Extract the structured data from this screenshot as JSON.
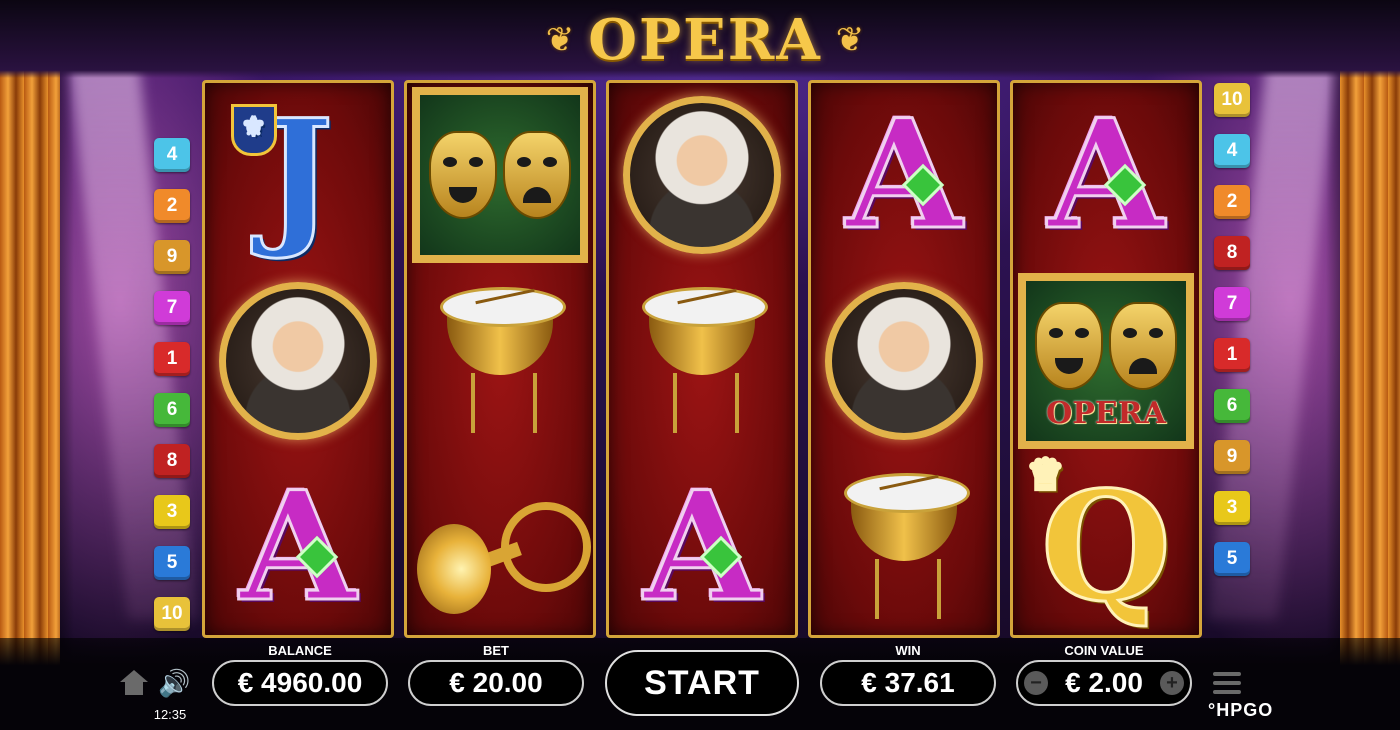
{
  "game": {
    "title": "OPERA",
    "title_color": "#f6c84a"
  },
  "reels": [
    [
      {
        "symbol": "J",
        "kind": "letter",
        "extra": "fleur-de-lis-crest"
      },
      {
        "symbol": "composer",
        "kind": "portrait"
      },
      {
        "symbol": "A",
        "kind": "letter",
        "extra": "green-gem"
      }
    ],
    [
      {
        "symbol": "masks",
        "kind": "masks",
        "label": ""
      },
      {
        "symbol": "timpani",
        "kind": "drum"
      },
      {
        "symbol": "horn",
        "kind": "horn"
      }
    ],
    [
      {
        "symbol": "composer",
        "kind": "portrait"
      },
      {
        "symbol": "timpani",
        "kind": "drum"
      },
      {
        "symbol": "A",
        "kind": "letter",
        "extra": "green-gem"
      }
    ],
    [
      {
        "symbol": "A",
        "kind": "letter",
        "extra": "green-gem"
      },
      {
        "symbol": "composer",
        "kind": "portrait"
      },
      {
        "symbol": "timpani",
        "kind": "drum"
      }
    ],
    [
      {
        "symbol": "A",
        "kind": "letter",
        "extra": "green-gem"
      },
      {
        "symbol": "masks",
        "kind": "masks",
        "label": "OPERA"
      },
      {
        "symbol": "Q",
        "kind": "letter",
        "extra": "crown"
      }
    ]
  ],
  "paylines": {
    "left": [
      {
        "n": "4",
        "color": "#4cc4e8"
      },
      {
        "n": "2",
        "color": "#f08a2a"
      },
      {
        "n": "9",
        "color": "#d8962a"
      },
      {
        "n": "7",
        "color": "#d03bd8"
      },
      {
        "n": "1",
        "color": "#d82a2a"
      },
      {
        "n": "6",
        "color": "#46b83a"
      },
      {
        "n": "8",
        "color": "#c02222"
      },
      {
        "n": "3",
        "color": "#e8c81a"
      },
      {
        "n": "5",
        "color": "#2a7ad8"
      },
      {
        "n": "10",
        "color": "#e8c23a"
      }
    ],
    "right": [
      {
        "n": "10",
        "color": "#e8c23a"
      },
      {
        "n": "4",
        "color": "#4cc4e8"
      },
      {
        "n": "2",
        "color": "#f08a2a"
      },
      {
        "n": "8",
        "color": "#c02222"
      },
      {
        "n": "7",
        "color": "#d03bd8"
      },
      {
        "n": "1",
        "color": "#d82a2a"
      },
      {
        "n": "6",
        "color": "#46b83a"
      },
      {
        "n": "9",
        "color": "#d8962a"
      },
      {
        "n": "3",
        "color": "#e8c81a"
      },
      {
        "n": "5",
        "color": "#2a7ad8"
      }
    ]
  },
  "controls": {
    "balance_label": "BALANCE",
    "balance_value": "€ 4960.00",
    "bet_label": "BET",
    "bet_value": "€ 20.00",
    "start_label": "START",
    "win_label": "WIN",
    "win_value": "€ 37.61",
    "coin_label": "COIN VALUE",
    "coin_value": "€ 2.00",
    "minus": "−",
    "plus": "+",
    "clock": "12:35",
    "brand": "°HPGO",
    "home_icon": "home-icon",
    "sound_icon": "speaker-icon",
    "menu_icon": "hamburger-menu-icon"
  }
}
